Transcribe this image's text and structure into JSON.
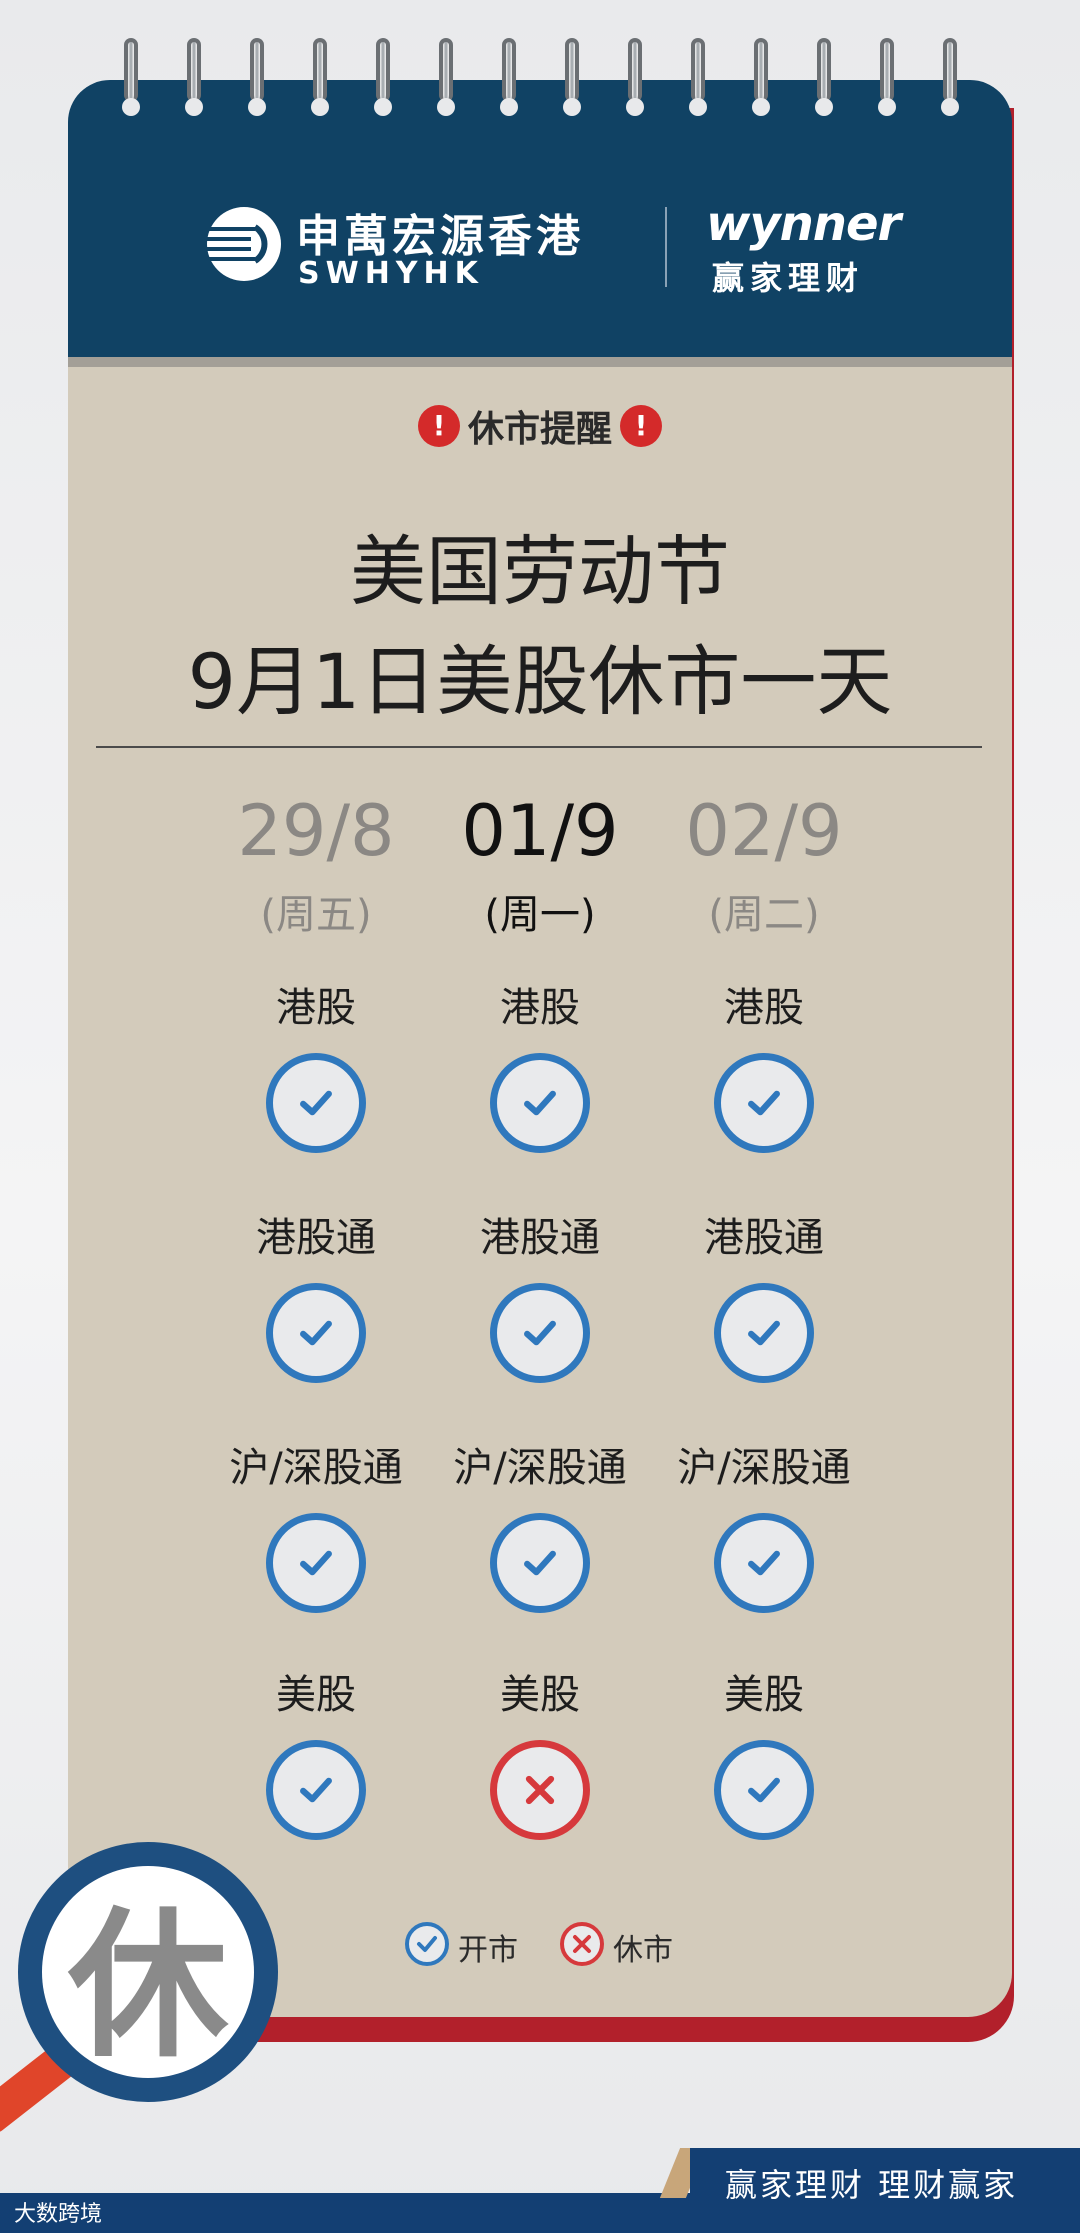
{
  "brand": {
    "company_cn": "申萬宏源香港",
    "company_en": "SWHYHK",
    "app_name": "wynner",
    "app_name_cn": "赢家理财"
  },
  "notice": {
    "alert_label": "休市提醒",
    "alert_icon": "exclamation-icon",
    "title_line1": "美国劳动节",
    "title_line2": "9月1日美股休市一天"
  },
  "days": [
    {
      "date": "29/8",
      "weekday": "(周五)",
      "highlight": false
    },
    {
      "date": "01/9",
      "weekday": "(周一)",
      "highlight": true
    },
    {
      "date": "02/9",
      "weekday": "(周二)",
      "highlight": false
    }
  ],
  "markets": [
    {
      "name": "港股",
      "status": [
        "open",
        "open",
        "open"
      ]
    },
    {
      "name": "港股通",
      "status": [
        "open",
        "open",
        "open"
      ]
    },
    {
      "name": "沪/深股通",
      "status": [
        "open",
        "open",
        "open"
      ]
    },
    {
      "name": "美股",
      "status": [
        "open",
        "closed",
        "open"
      ]
    }
  ],
  "legend": {
    "open_label": "开市",
    "closed_label": "休市"
  },
  "magnifier_char": "休",
  "footer": {
    "slogan": "赢家理财  理财赢家",
    "watermark": "大数跨境"
  },
  "colors": {
    "header": "#104264",
    "paper": "#d3cbbb",
    "open": "#2f78bd",
    "closed": "#d6393c",
    "alert": "#d42a2a",
    "footer": "#133f73"
  }
}
